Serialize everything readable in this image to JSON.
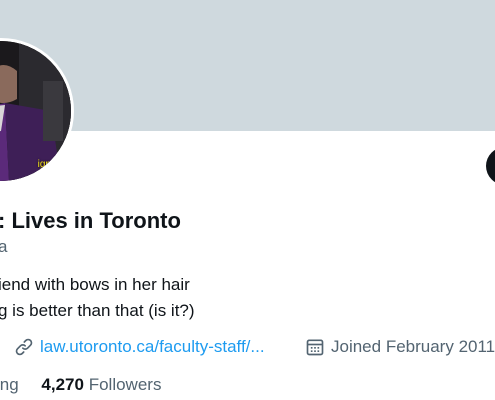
{
  "profile": {
    "avatar_caption": [
      "ign is",
      "cides",
      "tion"
    ],
    "display_name": ": Lives in Toronto",
    "handle": "a",
    "bio_lines": [
      "iend with bows in her hair",
      "g is better than that (is it?)"
    ],
    "link": {
      "icon": "link-icon",
      "text": "law.utoronto.ca/faculty-staff/..."
    },
    "joined": {
      "icon": "calendar-icon",
      "text": "Joined February 2011"
    },
    "following": {
      "label": "ing"
    },
    "followers": {
      "count": "4,270",
      "label": "Followers"
    }
  },
  "colors": {
    "banner": "#cfd9de",
    "link": "#1d9bf0",
    "secondary_text": "#536471",
    "primary_text": "#0f1419",
    "caption_yellow": "#f4e21a"
  }
}
